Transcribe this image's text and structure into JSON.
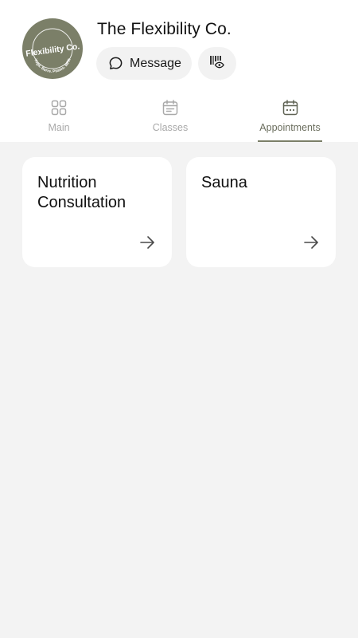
{
  "business": {
    "name": "The Flexibility Co.",
    "logo_text": "Flexibility Co.",
    "logo_tagline": "Yoga. Barre. Pilates. MFR",
    "brand_color": "#7b7f68"
  },
  "actions": {
    "message_label": "Message",
    "message_icon": "chat-bubble-icon",
    "pass_icon": "barcode-eye-icon"
  },
  "tabs": [
    {
      "label": "Main",
      "icon": "grid-icon",
      "active": false
    },
    {
      "label": "Classes",
      "icon": "calendar-icon",
      "active": false
    },
    {
      "label": "Appointments",
      "icon": "calendar-dots-icon",
      "active": true
    }
  ],
  "appointments": [
    {
      "title": "Nutrition Consultation",
      "icon": "arrow-right-icon"
    },
    {
      "title": "Sauna",
      "icon": "arrow-right-icon"
    }
  ]
}
